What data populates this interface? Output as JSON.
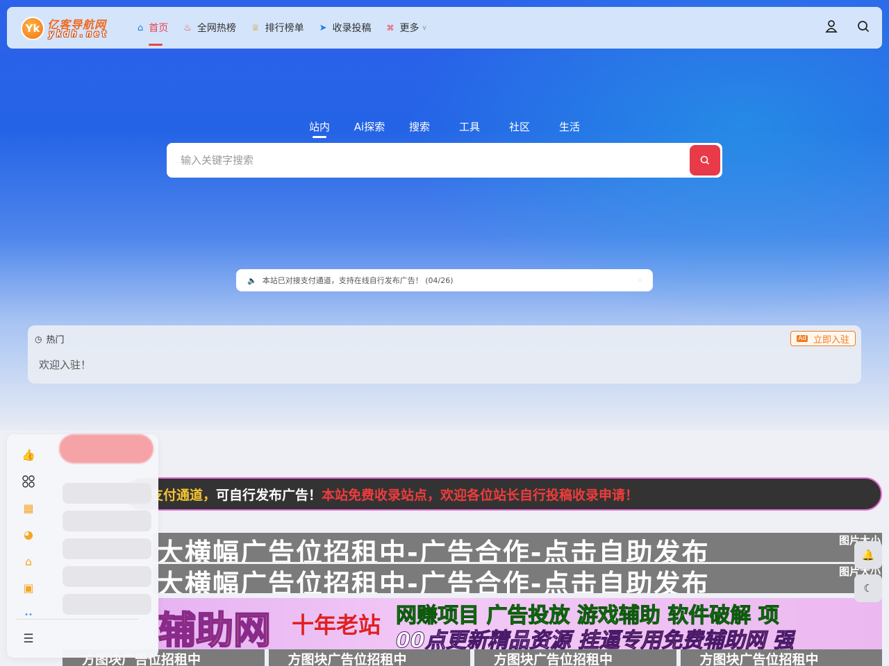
{
  "brand": {
    "logo_badge": "Yk",
    "logo_cn": "亿客导航网",
    "logo_en": "ykdh.net"
  },
  "nav": {
    "items": [
      {
        "label": "首页",
        "icon": "home-icon"
      },
      {
        "label": "全网热榜",
        "icon": "fire-icon"
      },
      {
        "label": "排行榜单",
        "icon": "trophy-icon"
      },
      {
        "label": "收录投稿",
        "icon": "paper-plane-icon"
      },
      {
        "label": "更多",
        "icon": "grid-icon"
      }
    ],
    "active_index": 0
  },
  "search": {
    "tabs": [
      "站内",
      "Ai探索",
      "搜索",
      "工具",
      "社区",
      "生活"
    ],
    "active_tab": "站内",
    "placeholder": "输入关键字搜索"
  },
  "notice": {
    "text": "本站已对接支付通道，支持在线自行发布广告！ (04/26)"
  },
  "hot": {
    "title": "热门",
    "button": "立即入驻",
    "button_badge": "Ad",
    "text": "欢迎入驻！"
  },
  "marquee": {
    "part_a": "支付通道，",
    "part_b": "可自行发布广告！",
    "part_c": "本站免费收录站点，欢迎各位站长自行投稿收录申请！"
  },
  "banners": {
    "b1_text": "大横幅广告位招租中-广告合作-点击自助发布",
    "b1_tag": "图片大小",
    "b2_text": "大横幅广告位招租中-广告合作-点击自助发布",
    "b2_tag": "图片大小",
    "b3_main": "辅助网",
    "b3_old": "十年老站",
    "b3_top": "网赚项目 广告投放 游戏辅助 软件破解 项",
    "b3_bottom_a": "00点更新精品资源 ",
    "b3_bottom_b": "挂逼专用免费辅助网 强",
    "bottom_cells": [
      "方图块广告位招租中",
      "方图块广告位招租中",
      "方图块广告位招租中",
      "方图块广告位招租中"
    ]
  },
  "colors": {
    "accent": "#e83a48",
    "orange": "#f07b1f",
    "hero_blue": "#2463e6"
  }
}
